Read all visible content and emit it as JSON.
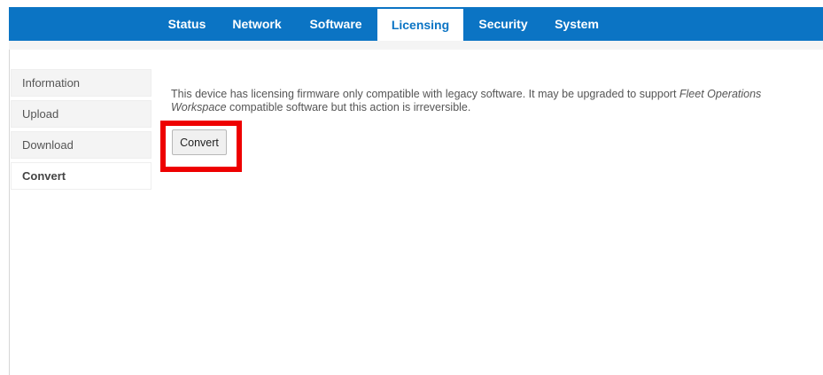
{
  "nav": {
    "tabs": [
      {
        "label": "Status"
      },
      {
        "label": "Network"
      },
      {
        "label": "Software"
      },
      {
        "label": "Licensing",
        "active": true
      },
      {
        "label": "Security"
      },
      {
        "label": "System"
      }
    ]
  },
  "sidebar": {
    "items": [
      {
        "label": "Information"
      },
      {
        "label": "Upload"
      },
      {
        "label": "Download"
      },
      {
        "label": "Convert",
        "active": true
      }
    ]
  },
  "content": {
    "message_part1": "This device has licensing firmware only compatible with legacy software. It may be upgraded to support ",
    "message_emphasis": "Fleet Operations Workspace",
    "message_part2": " compatible software but this action is irreversible.",
    "convert_button": "Convert"
  },
  "colors": {
    "brand_blue": "#0b74c4",
    "highlight_red": "#ee0000"
  }
}
